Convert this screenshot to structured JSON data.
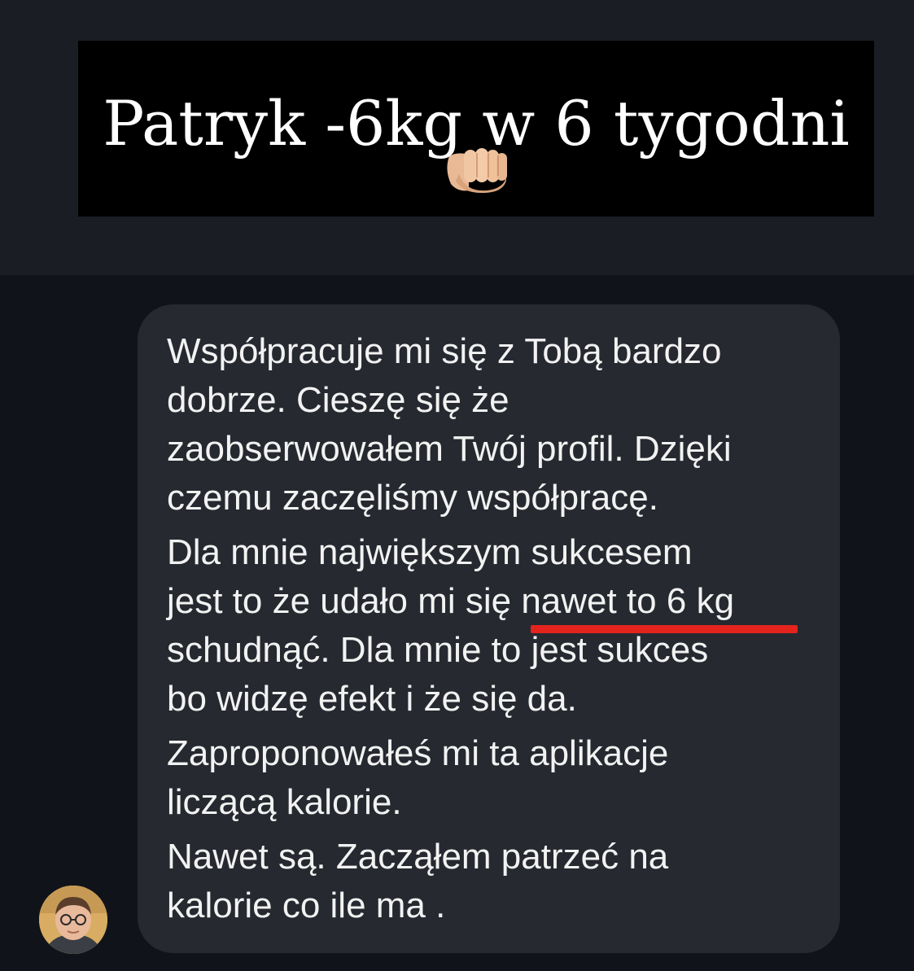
{
  "header": {
    "title": "Patryk -6kg w 6 tygodni",
    "emoji_icon": "fist-bump-icon"
  },
  "message": {
    "lines": [
      "Współpracuje mi się z Tobą bardzo",
      "dobrze. Cieszę się że",
      "zaobserwowałem Twój profil. Dzięki",
      "czemu zaczęliśmy współpracę.",
      "Dla mnie największym sukcesem",
      "jest to że udało mi się nawet to 6 kg",
      "schudnąć. Dla mnie to jest sukces",
      "bo widzę efekt i że się da.",
      "Zaproponowałeś  mi ta aplikacje",
      "liczącą kalorie.",
      "Nawet są. Zacząłem patrzeć na",
      "kalorie co ile ma ."
    ],
    "highlight_color": "#e4231d"
  },
  "sender": {
    "avatar_icon": "user-avatar-photo"
  },
  "colors": {
    "background": "#10141a",
    "header_band": "#1a1d24",
    "title_box": "#000000",
    "bubble": "#262930",
    "text": "#f2f2f2"
  }
}
